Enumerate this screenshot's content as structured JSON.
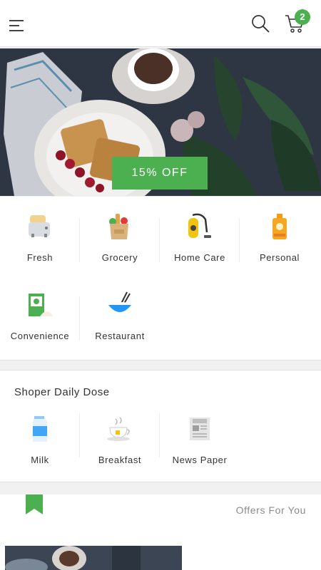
{
  "header": {
    "menu_icon": "menu-icon",
    "search_icon": "search-icon",
    "cart_icon": "cart-icon",
    "cart_count": "2",
    "accent_color": "#4caf50"
  },
  "banner": {
    "offer_label": "15% OFF"
  },
  "categories": [
    {
      "label": "Fresh",
      "icon": "toaster-icon"
    },
    {
      "label": "Grocery",
      "icon": "grocery-bag-icon"
    },
    {
      "label": "Home Care",
      "icon": "vacuum-cleaner-icon"
    },
    {
      "label": "Personal",
      "icon": "sunscreen-bottle-icon"
    },
    {
      "label": "Convenience",
      "icon": "cereal-box-icon"
    },
    {
      "label": "Restaurant",
      "icon": "bowl-chopsticks-icon"
    }
  ],
  "daily_dose": {
    "title": "Shoper Daily Dose",
    "items": [
      {
        "label": "Milk",
        "icon": "milk-carton-icon"
      },
      {
        "label": "Breakfast",
        "icon": "tea-cup-icon"
      },
      {
        "label": "News Paper",
        "icon": "newspaper-icon"
      }
    ]
  },
  "offers": {
    "title": "Offers For You",
    "bookmark_icon": "bookmark-icon"
  }
}
